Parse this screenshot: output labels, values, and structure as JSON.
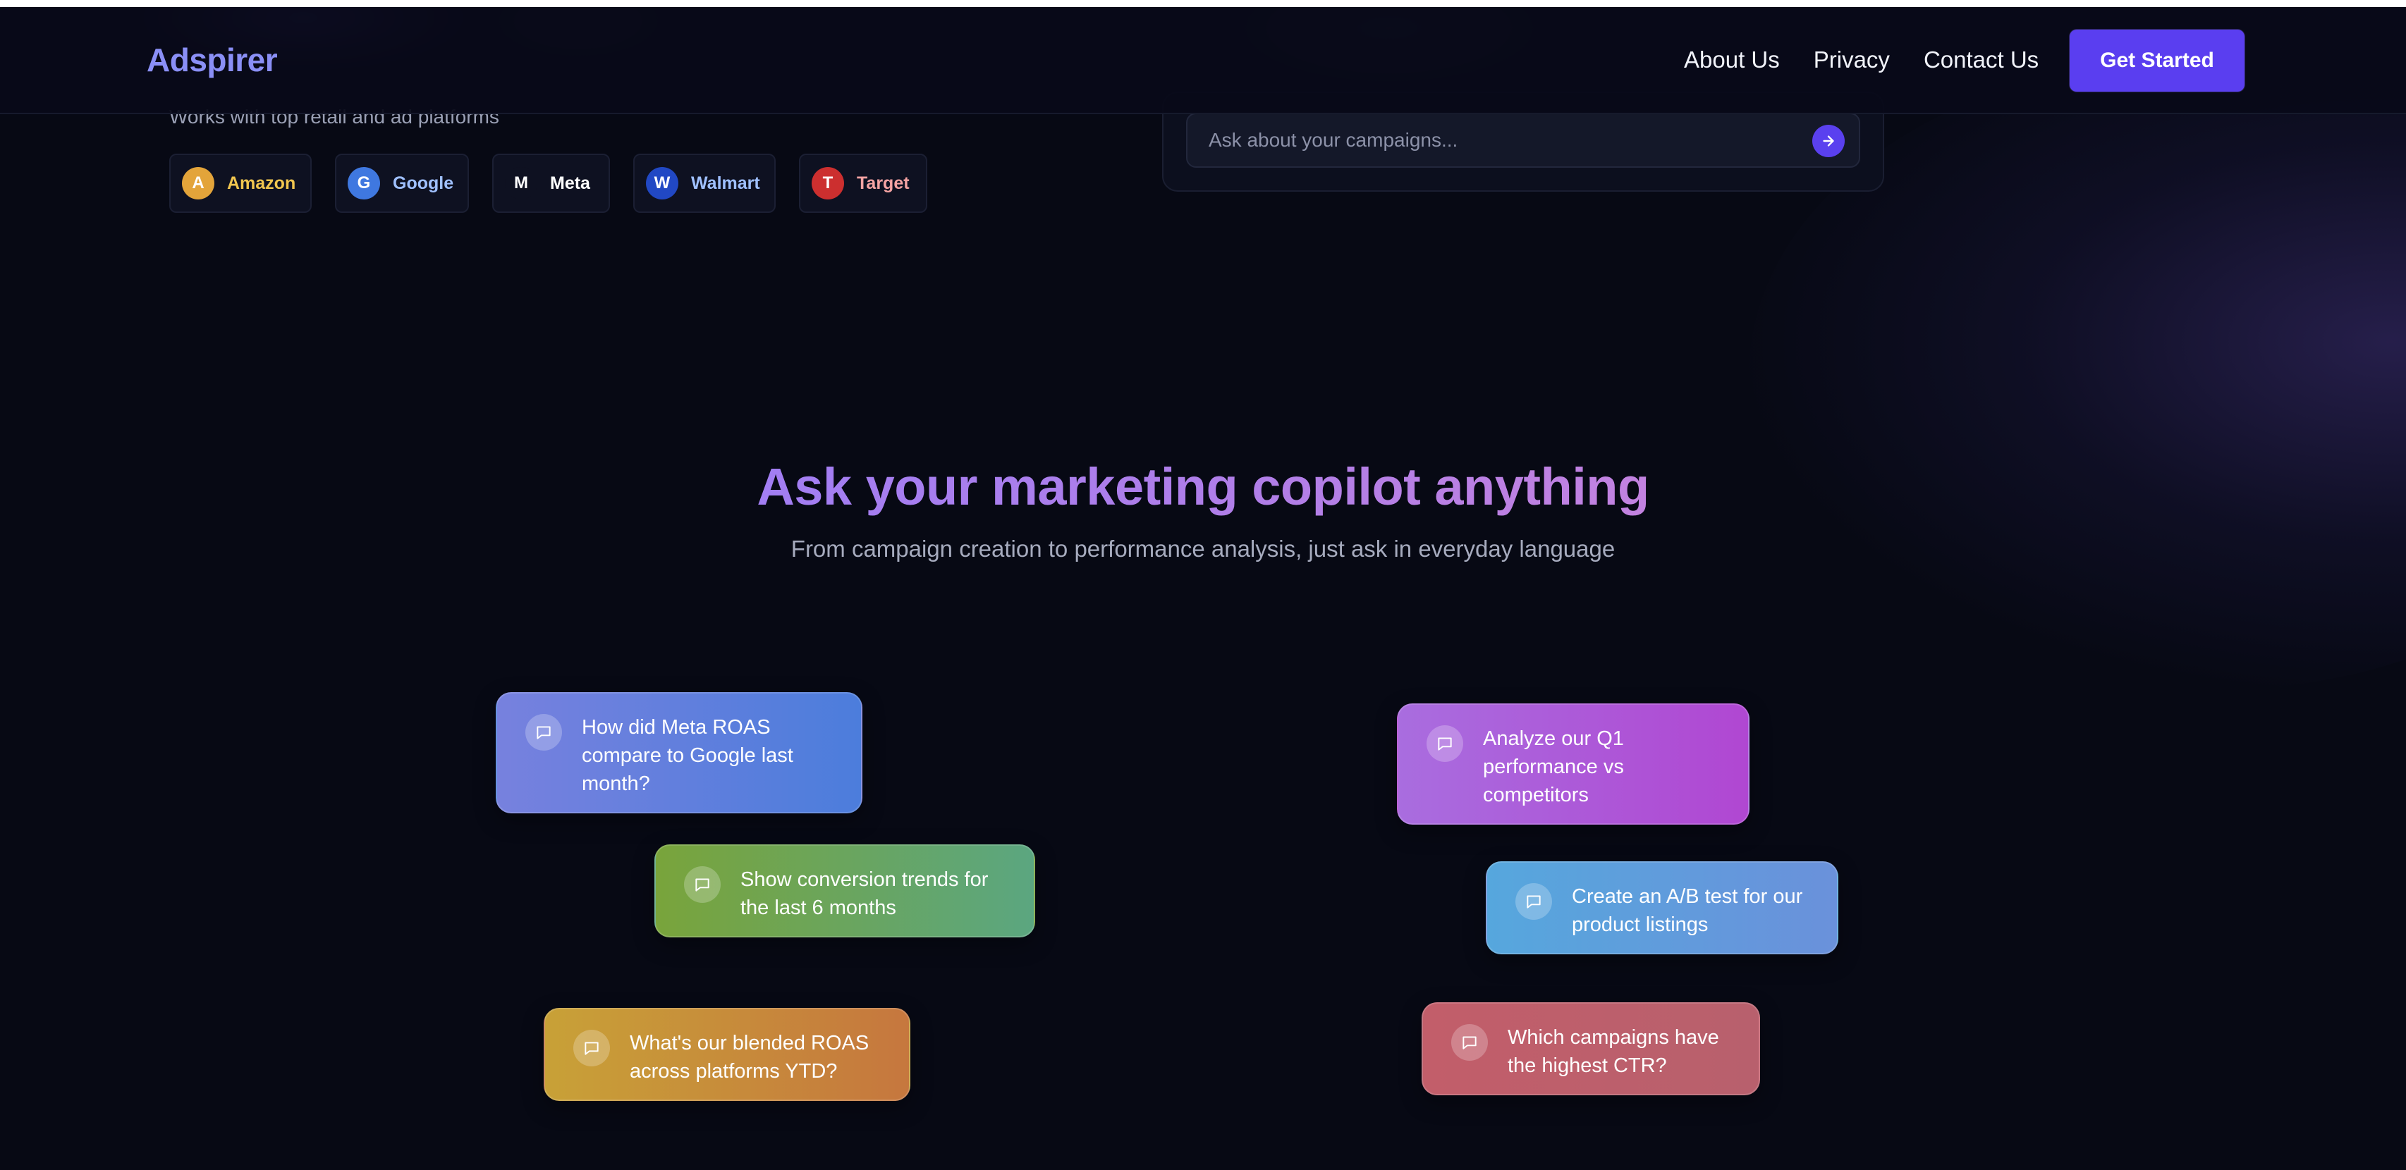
{
  "header": {
    "logo": "Adspirer",
    "nav": [
      "About Us",
      "Privacy",
      "Contact Us"
    ],
    "cta_label": "Get Started"
  },
  "hero": {
    "works_with_label": "Works with top retail and ad platforms",
    "platforms": [
      {
        "initial": "A",
        "name": "Amazon",
        "icon_color": "#e3a43a",
        "text_color": "#f1c64f"
      },
      {
        "initial": "G",
        "name": "Google",
        "icon_color": "#3f78e0",
        "text_color": "#9fc0ff"
      },
      {
        "initial": "M",
        "name": "Meta",
        "icon_color": "#0e1121",
        "text_color": "#ffffff"
      },
      {
        "initial": "W",
        "name": "Walmart",
        "icon_color": "#2148c4",
        "text_color": "#9fc0ff"
      },
      {
        "initial": "T",
        "name": "Target",
        "icon_color": "#cc2f2f",
        "text_color": "#f5a3a3"
      }
    ],
    "chat_placeholder": "Ask about your campaigns...",
    "send_icon": "arrow-right-icon"
  },
  "section": {
    "title": "Ask your marketing copilot anything",
    "subtitle": "From campaign creation to performance analysis, just ask in everyday language"
  },
  "prompts": [
    {
      "text": "How did Meta ROAS compare to Google last month?",
      "icon": "chat-bubble-icon"
    },
    {
      "text": "Show conversion trends for the last 6 months",
      "icon": "chat-bubble-icon"
    },
    {
      "text": "What's our blended ROAS across platforms YTD?",
      "icon": "chat-bubble-icon"
    },
    {
      "text": "Analyze our Q1 performance vs competitors",
      "icon": "chat-bubble-icon"
    },
    {
      "text": "Create an A/B test for our product listings",
      "icon": "chat-bubble-icon"
    },
    {
      "text": "Which campaigns have the highest CTR?",
      "icon": "chat-bubble-icon"
    }
  ],
  "colors": {
    "accent": "#5a3ef0",
    "background": "#070914",
    "logo": "#8a8ff6"
  }
}
